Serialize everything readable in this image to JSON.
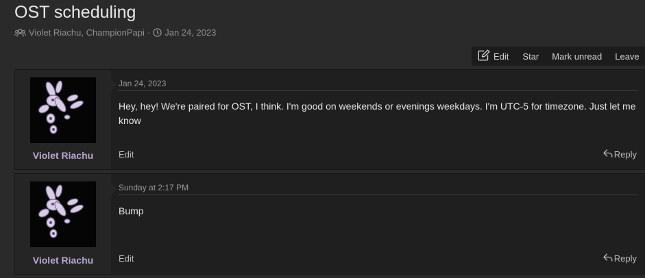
{
  "thread": {
    "title": "OST scheduling",
    "participants": "Violet Riachu, ChampionPapi",
    "separator": "·",
    "start_date": "Jan 24, 2023"
  },
  "toolbar": {
    "edit": "Edit",
    "star": "Star",
    "mark_unread": "Mark unread",
    "leave": "Leave"
  },
  "messages": [
    {
      "username": "Violet Riachu",
      "date": "Jan 24, 2023",
      "body": "Hey, hey! We're paired for OST, I think. I'm good on weekends or evenings weekdays. I'm UTC-5 for timezone. Just let me know",
      "edit": "Edit",
      "reply": "Reply"
    },
    {
      "username": "Violet Riachu",
      "date": "Sunday at 2:17 PM",
      "body": "Bump",
      "edit": "Edit",
      "reply": "Reply"
    }
  ],
  "colors": {
    "page_bg": "#2a2a2a",
    "message_bg": "#1f1f1f",
    "user_cell_bg": "#252525",
    "username": "#b6a7ce"
  },
  "icons": {
    "participants": "users-icon",
    "date": "clock-icon",
    "edit": "edit-icon",
    "reply": "reply-icon"
  }
}
